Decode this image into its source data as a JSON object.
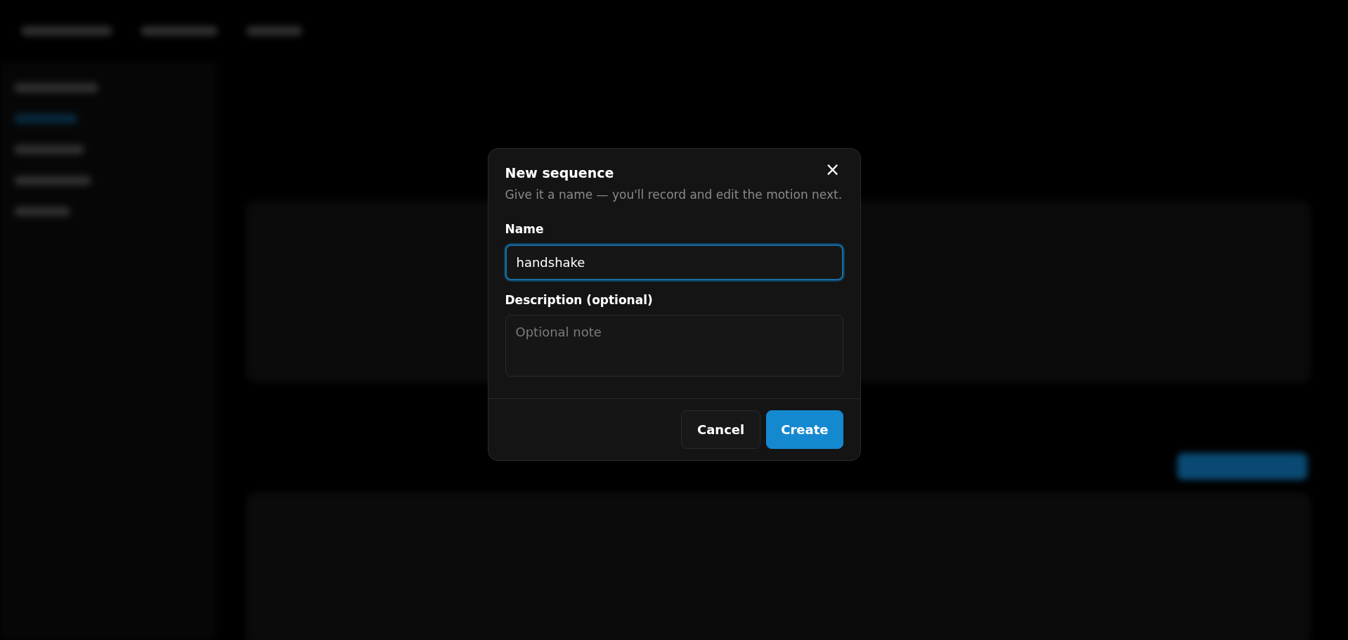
{
  "dialog": {
    "title": "New sequence",
    "description": "Give it a name — you'll record and edit the motion next.",
    "close_label": "×",
    "fields": [
      {
        "kind": "input",
        "label": "Name",
        "value": "handshake",
        "focused": true
      },
      {
        "kind": "textarea",
        "label": "Description (optional)",
        "placeholder": "Optional note",
        "focused": false
      }
    ],
    "buttons": [
      {
        "label": "Cancel",
        "kind": "secondary"
      },
      {
        "label": "Create",
        "kind": "primary"
      }
    ]
  }
}
